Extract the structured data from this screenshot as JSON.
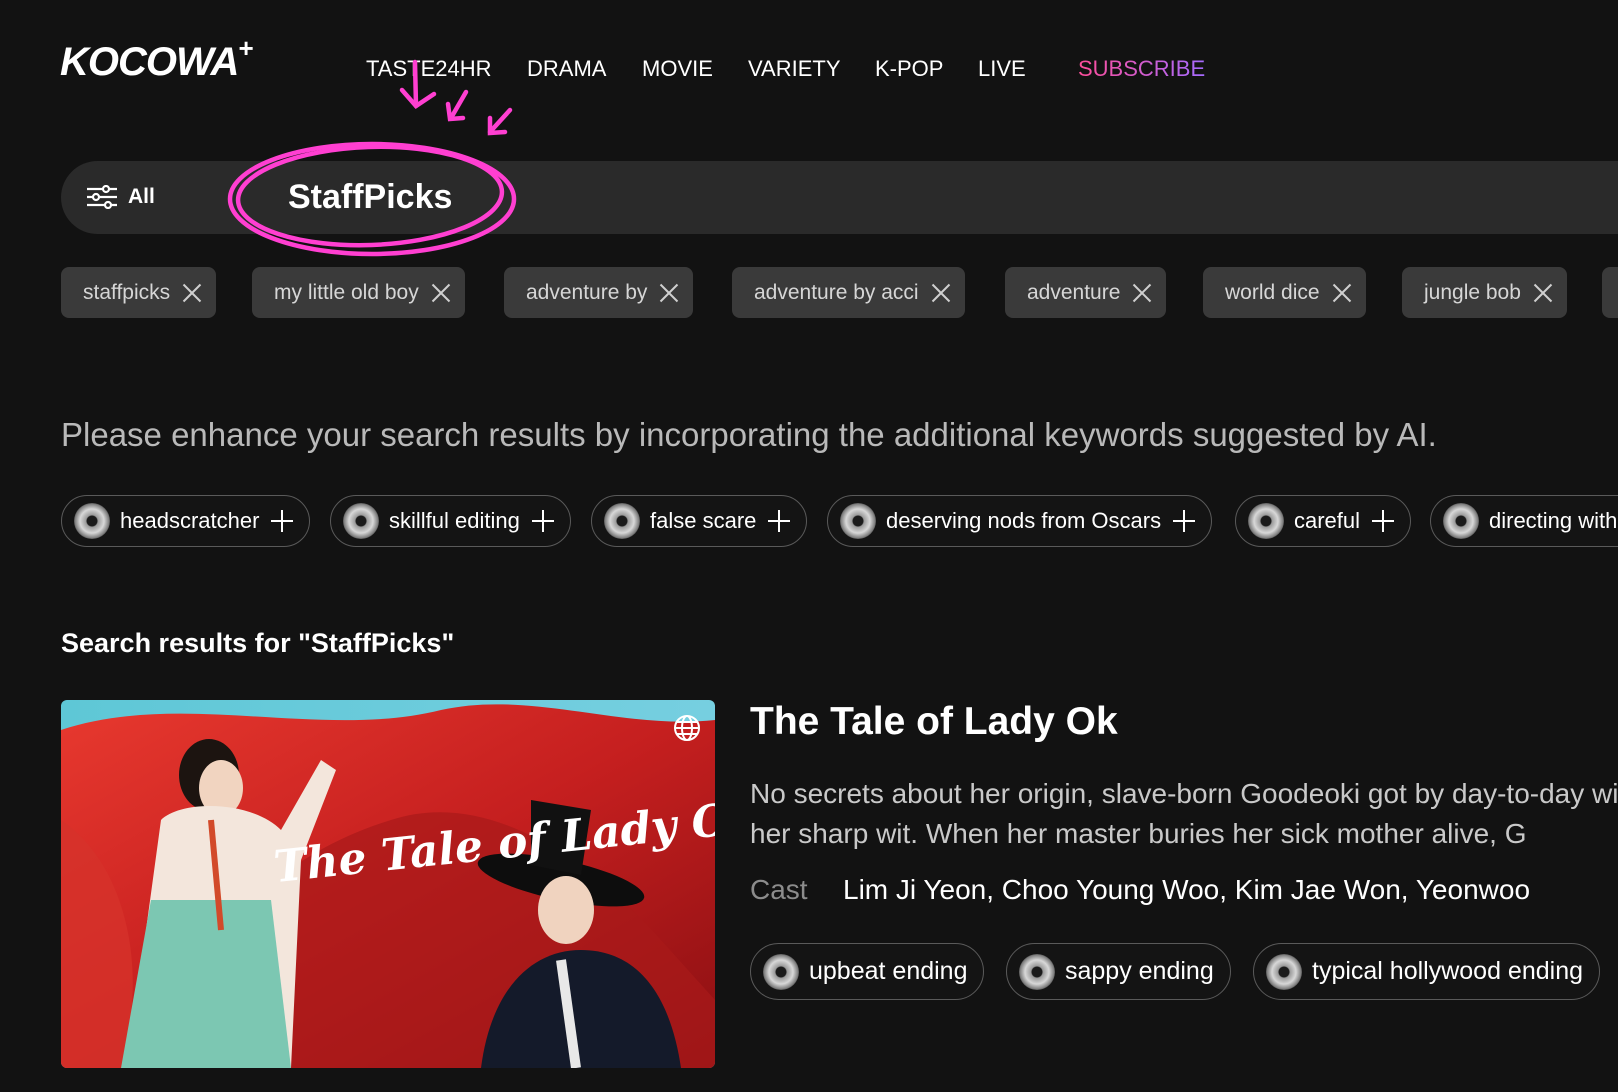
{
  "header": {
    "logo": "KOCOWA",
    "logo_plus": "+",
    "nav": [
      "TASTE24HR",
      "DRAMA",
      "MOVIE",
      "VARIETY",
      "K-POP",
      "LIVE"
    ],
    "subscribe": "SUBSCRIBE"
  },
  "search": {
    "filter_label": "All",
    "query": "StaffPicks"
  },
  "recent_searches": [
    "staffpicks",
    "my little old boy",
    "adventure by",
    "adventure by acci",
    "adventure",
    "world dice",
    "jungle bob"
  ],
  "ai_hint": "Please enhance your search results by incorporating the additional keywords suggested by AI.",
  "ai_keywords": [
    "headscratcher",
    "skillful editing",
    "false scare",
    "deserving nods from Oscars",
    "careful",
    "directing with"
  ],
  "results": {
    "heading": "Search results for \"StaffPicks\"",
    "item": {
      "title": "The Tale of Lady Ok",
      "poster_title": "The Tale of Lady Ok",
      "description": "No secrets about her origin, slave-born Goodeoki got by day-to-day with her sharp wit. When her master buries her sick mother alive, G",
      "cast_label": "Cast",
      "cast": "Lim Ji Yeon, Choo Young Woo, Kim Jae Won, Yeonwoo",
      "tags": [
        "upbeat ending",
        "sappy ending",
        "typical hollywood ending"
      ]
    }
  },
  "colors": {
    "background": "#121212",
    "annotation": "#ff3fd1",
    "subscribe_gradient": [
      "#ff4d9a",
      "#a66bff"
    ]
  }
}
